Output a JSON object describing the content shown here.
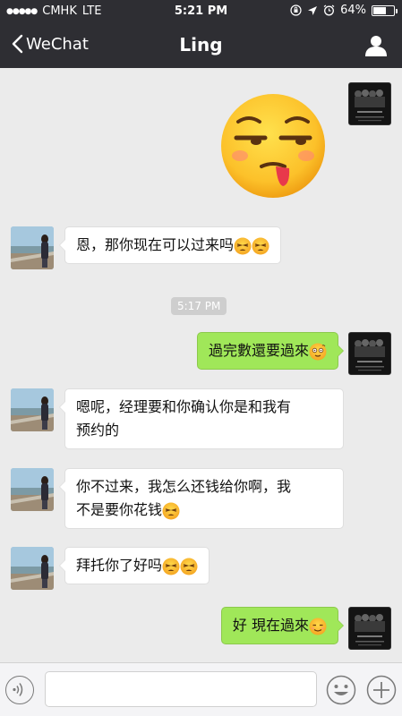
{
  "status_bar": {
    "carrier": "CMHK",
    "network": "LTE",
    "time": "5:21 PM",
    "battery": "64%",
    "battery_level": 0.64
  },
  "nav": {
    "back_label": "WeChat",
    "title": "Ling"
  },
  "chat": {
    "timestamp": "5:17 PM",
    "messages": [
      {
        "side": "left",
        "text": "恩，那你现在可以过来吗"
      },
      {
        "side": "right",
        "text": "過完數還要過來"
      },
      {
        "side": "left",
        "line1": "嗯呢，经理要和你确认你是和我有",
        "line2": "预约的"
      },
      {
        "side": "left",
        "line1": "你不过来，我怎么还钱给你啊，我",
        "line2": "不是要你花钱"
      },
      {
        "side": "left",
        "text": "拜托你了好吗"
      },
      {
        "side": "right",
        "text": "好 現在過來"
      }
    ]
  },
  "input": {
    "value": "",
    "placeholder": ""
  },
  "colors": {
    "bar": "#2e2e33",
    "chat_bg": "#ebebeb",
    "my_bubble": "#a0e759"
  },
  "icons": {
    "back": "chevron-left-icon",
    "profile": "person-icon",
    "voice": "voice-icon",
    "emoji": "smiley-icon",
    "plus": "plus-icon"
  }
}
